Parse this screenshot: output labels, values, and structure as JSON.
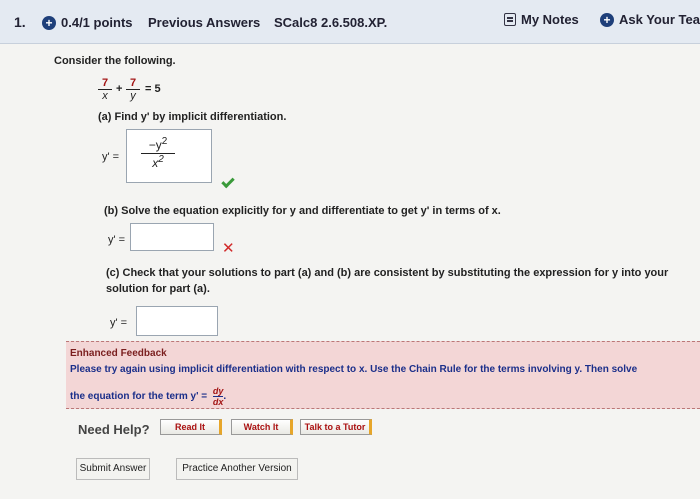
{
  "header": {
    "question_number": "1.",
    "points": "0.4/1 points",
    "previous_answers": "Previous Answers",
    "assignment_id": "SCalc8 2.6.508.XP.",
    "my_notes": "My Notes",
    "ask_teacher": "Ask Your Tea"
  },
  "problem": {
    "intro": "Consider the following.",
    "equation": {
      "frac1_num": "7",
      "frac1_den": "x",
      "plus": "+",
      "frac2_num": "7",
      "frac2_den": "y",
      "rhs": "= 5"
    }
  },
  "part_a": {
    "prompt": "(a) Find y' by implicit differentiation.",
    "answer_label": "y' =",
    "answer_num": "−y",
    "answer_num_exp": "2",
    "answer_den": "x",
    "answer_den_exp": "2",
    "status": "correct"
  },
  "part_b": {
    "prompt": "(b) Solve the equation explicitly for y and differentiate to get y' in terms of x.",
    "answer_label": "y' =",
    "value": "",
    "status": "incorrect"
  },
  "part_c": {
    "prompt_line1": "(c) Check that your solutions to part (a) and (b) are consistent by substituting the expression for y into your",
    "prompt_line2": "solution for part (a).",
    "answer_label": "y' =",
    "value": ""
  },
  "feedback": {
    "title": "Enhanced Feedback",
    "line1": "Please try again using implicit differentiation with respect to x. Use the Chain Rule for the terms involving y. Then solve",
    "line2": "the equation for the term  y' =",
    "dy": "dy",
    "dx": "dx",
    "period": "."
  },
  "help": {
    "label": "Need Help?",
    "read_it": "Read It",
    "watch_it": "Watch It",
    "talk_tutor": "Talk to a Tutor"
  },
  "actions": {
    "submit": "Submit Answer",
    "practice": "Practice Another Version"
  },
  "colors": {
    "header_bg": "#e4eaf2",
    "feedback_bg": "#f3d6d6",
    "correct": "#3a9a3a",
    "incorrect": "#d12a2a"
  }
}
